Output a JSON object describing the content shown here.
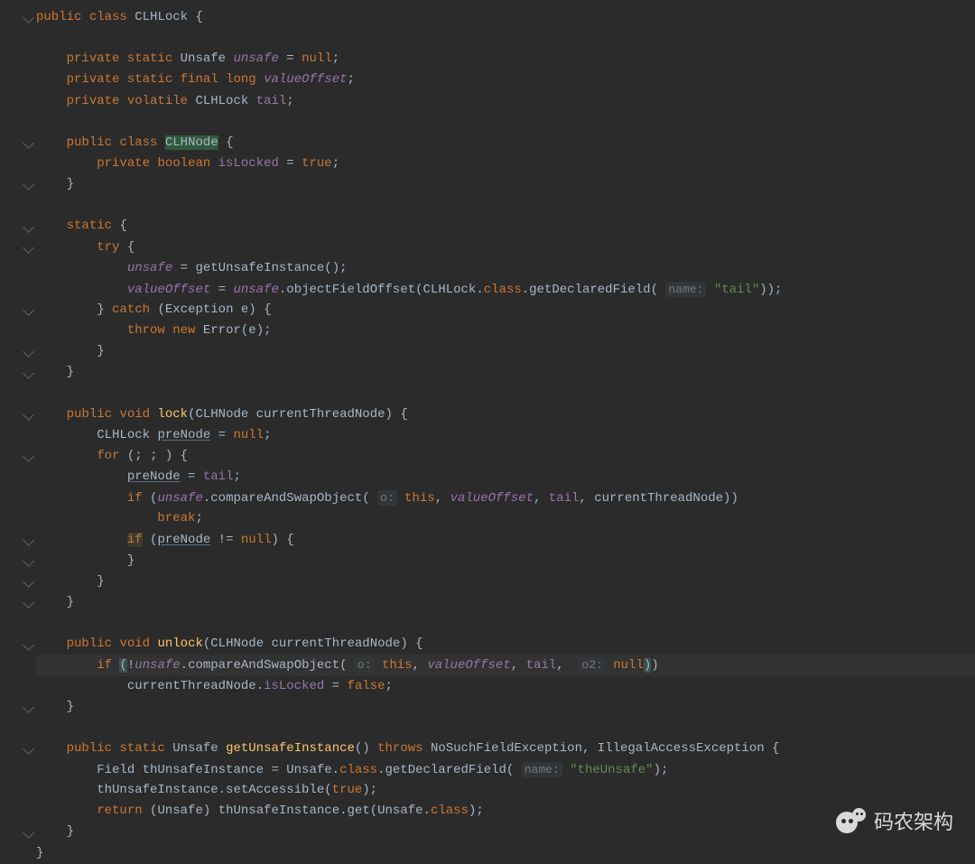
{
  "code": {
    "tokens": [
      [
        [
          "kw",
          "public"
        ],
        [
          "",
          " "
        ],
        [
          "kw",
          "class"
        ],
        [
          "",
          " "
        ],
        [
          "ident",
          "CLHLock "
        ],
        [
          "punct",
          "{"
        ]
      ],
      [],
      [
        [
          "",
          "    "
        ],
        [
          "kw",
          "private"
        ],
        [
          "",
          " "
        ],
        [
          "kw",
          "static"
        ],
        [
          "",
          " "
        ],
        [
          "ident",
          "Unsafe "
        ],
        [
          "field-it",
          "unsafe"
        ],
        [
          "",
          " = "
        ],
        [
          "kw",
          "null"
        ],
        [
          "punct",
          ";"
        ]
      ],
      [
        [
          "",
          "    "
        ],
        [
          "kw",
          "private"
        ],
        [
          "",
          " "
        ],
        [
          "kw",
          "static"
        ],
        [
          "",
          " "
        ],
        [
          "kw",
          "final"
        ],
        [
          "",
          " "
        ],
        [
          "kw",
          "long"
        ],
        [
          "",
          " "
        ],
        [
          "field-it",
          "valueOffset"
        ],
        [
          "punct",
          ";"
        ]
      ],
      [
        [
          "",
          "    "
        ],
        [
          "kw",
          "private"
        ],
        [
          "",
          " "
        ],
        [
          "kw",
          "volatile"
        ],
        [
          "",
          " "
        ],
        [
          "ident",
          "CLHLock "
        ],
        [
          "field",
          "tail"
        ],
        [
          "punct",
          ";"
        ]
      ],
      [],
      [
        [
          "",
          "    "
        ],
        [
          "kw",
          "public"
        ],
        [
          "",
          " "
        ],
        [
          "kw",
          "class"
        ],
        [
          "",
          " "
        ],
        [
          "ident highlight-ident",
          "CLHNode"
        ],
        [
          "",
          " "
        ],
        [
          "punct",
          "{"
        ]
      ],
      [
        [
          "",
          "        "
        ],
        [
          "kw",
          "private"
        ],
        [
          "",
          " "
        ],
        [
          "kw",
          "boolean"
        ],
        [
          "",
          " "
        ],
        [
          "field",
          "isLocked"
        ],
        [
          "",
          " = "
        ],
        [
          "kw",
          "true"
        ],
        [
          "punct",
          ";"
        ]
      ],
      [
        [
          "",
          "    "
        ],
        [
          "punct",
          "}"
        ]
      ],
      [],
      [
        [
          "",
          "    "
        ],
        [
          "kw",
          "static"
        ],
        [
          "",
          " "
        ],
        [
          "punct",
          "{"
        ]
      ],
      [
        [
          "",
          "        "
        ],
        [
          "kw",
          "try"
        ],
        [
          "",
          " "
        ],
        [
          "punct",
          "{"
        ]
      ],
      [
        [
          "",
          "            "
        ],
        [
          "field-it",
          "unsafe"
        ],
        [
          "",
          " = "
        ],
        [
          "ident",
          "getUnsafeInstance"
        ],
        [
          "punct",
          "();"
        ]
      ],
      [
        [
          "",
          "            "
        ],
        [
          "field-it",
          "valueOffset"
        ],
        [
          "",
          " = "
        ],
        [
          "field-it",
          "unsafe"
        ],
        [
          "punct",
          "."
        ],
        [
          "ident",
          "objectFieldOffset(CLHLock."
        ],
        [
          "kw",
          "class"
        ],
        [
          "punct",
          "."
        ],
        [
          "ident",
          "getDeclaredField("
        ],
        [
          "",
          " "
        ],
        [
          "param-hint",
          "name:"
        ],
        [
          "",
          " "
        ],
        [
          "str",
          "\"tail\""
        ],
        [
          "punct",
          "));"
        ]
      ],
      [
        [
          "",
          "        "
        ],
        [
          "punct",
          "} "
        ],
        [
          "kw",
          "catch"
        ],
        [
          "",
          " "
        ],
        [
          "punct",
          "("
        ],
        [
          "ident",
          "Exception e"
        ],
        [
          "punct",
          ") {"
        ]
      ],
      [
        [
          "",
          "            "
        ],
        [
          "kw",
          "throw"
        ],
        [
          "",
          " "
        ],
        [
          "kw",
          "new"
        ],
        [
          "",
          " "
        ],
        [
          "ident",
          "Error(e"
        ],
        [
          "punct",
          ");"
        ]
      ],
      [
        [
          "",
          "        "
        ],
        [
          "punct",
          "}"
        ]
      ],
      [
        [
          "",
          "    "
        ],
        [
          "punct",
          "}"
        ]
      ],
      [],
      [
        [
          "",
          "    "
        ],
        [
          "kw",
          "public"
        ],
        [
          "",
          " "
        ],
        [
          "kw",
          "void"
        ],
        [
          "",
          " "
        ],
        [
          "funcdef",
          "lock"
        ],
        [
          "punct",
          "("
        ],
        [
          "ident",
          "CLHNode currentThreadNode"
        ],
        [
          "punct",
          ") {"
        ]
      ],
      [
        [
          "",
          "        "
        ],
        [
          "ident",
          "CLHLock "
        ],
        [
          "ident underline",
          "preNode"
        ],
        [
          "",
          " = "
        ],
        [
          "kw",
          "null"
        ],
        [
          "punct",
          ";"
        ]
      ],
      [
        [
          "",
          "        "
        ],
        [
          "kw",
          "for"
        ],
        [
          "",
          " "
        ],
        [
          "punct",
          "("
        ],
        [
          "punct",
          ";"
        ],
        [
          "",
          " "
        ],
        [
          "punct",
          ";"
        ],
        [
          "",
          " "
        ],
        [
          "punct",
          ") {"
        ]
      ],
      [
        [
          "",
          "            "
        ],
        [
          "ident underline",
          "preNode"
        ],
        [
          "",
          " = "
        ],
        [
          "field",
          "tail"
        ],
        [
          "punct",
          ";"
        ]
      ],
      [
        [
          "",
          "            "
        ],
        [
          "kw",
          "if"
        ],
        [
          "",
          " "
        ],
        [
          "punct",
          "("
        ],
        [
          "field-it",
          "unsafe"
        ],
        [
          "punct",
          "."
        ],
        [
          "ident",
          "compareAndSwapObject("
        ],
        [
          "",
          " "
        ],
        [
          "param-hint",
          "o:"
        ],
        [
          "",
          " "
        ],
        [
          "kw",
          "this"
        ],
        [
          "punct",
          ","
        ],
        [
          "",
          " "
        ],
        [
          "field-it",
          "valueOffset"
        ],
        [
          "punct",
          ","
        ],
        [
          "",
          " "
        ],
        [
          "field",
          "tail"
        ],
        [
          "punct",
          ","
        ],
        [
          "",
          " "
        ],
        [
          "ident",
          "currentThreadNode"
        ],
        [
          "punct",
          "))"
        ]
      ],
      [
        [
          "",
          "                "
        ],
        [
          "kw",
          "break"
        ],
        [
          "punct",
          ";"
        ]
      ],
      [
        [
          "",
          "            "
        ],
        [
          "kw hlbox-y",
          "if"
        ],
        [
          "",
          " "
        ],
        [
          "punct",
          "("
        ],
        [
          "ident underline",
          "preNode"
        ],
        [
          "",
          " != "
        ],
        [
          "kw",
          "null"
        ],
        [
          "punct",
          ") {"
        ]
      ],
      [
        [
          "",
          "            "
        ],
        [
          "punct",
          "}"
        ]
      ],
      [
        [
          "",
          "        "
        ],
        [
          "punct",
          "}"
        ]
      ],
      [
        [
          "",
          "    "
        ],
        [
          "punct",
          "}"
        ]
      ],
      [],
      [
        [
          "",
          "    "
        ],
        [
          "kw",
          "public"
        ],
        [
          "",
          " "
        ],
        [
          "kw",
          "void"
        ],
        [
          "",
          " "
        ],
        [
          "funcdef",
          "unlock"
        ],
        [
          "punct",
          "("
        ],
        [
          "ident",
          "CLHNode currentThreadNode"
        ],
        [
          "punct",
          ") {"
        ]
      ],
      [
        [
          "",
          "        "
        ],
        [
          "kw",
          "if"
        ],
        [
          "",
          " "
        ],
        [
          "punct paren-match",
          "("
        ],
        [
          "punct",
          "!"
        ],
        [
          "field-it",
          "unsafe"
        ],
        [
          "punct",
          "."
        ],
        [
          "ident",
          "compareAndSwapObject("
        ],
        [
          "",
          " "
        ],
        [
          "param-hint",
          "o:"
        ],
        [
          "",
          " "
        ],
        [
          "kw",
          "this"
        ],
        [
          "punct",
          ","
        ],
        [
          "",
          " "
        ],
        [
          "field-it",
          "valueOffset"
        ],
        [
          "punct",
          ","
        ],
        [
          "",
          " "
        ],
        [
          "field",
          "tail"
        ],
        [
          "punct",
          ","
        ],
        [
          "",
          "  "
        ],
        [
          "param-hint",
          "o2:"
        ],
        [
          "",
          " "
        ],
        [
          "kw",
          "null"
        ],
        [
          "punct paren-match",
          ")"
        ],
        [
          "punct",
          ")"
        ]
      ],
      [
        [
          "",
          "            "
        ],
        [
          "ident",
          "currentThreadNode."
        ],
        [
          "field",
          "isLocked"
        ],
        [
          "",
          " = "
        ],
        [
          "kw",
          "false"
        ],
        [
          "punct",
          ";"
        ]
      ],
      [
        [
          "",
          "    "
        ],
        [
          "punct",
          "}"
        ]
      ],
      [],
      [
        [
          "",
          "    "
        ],
        [
          "kw",
          "public"
        ],
        [
          "",
          " "
        ],
        [
          "kw",
          "static"
        ],
        [
          "",
          " "
        ],
        [
          "ident",
          "Unsafe "
        ],
        [
          "funcdef",
          "getUnsafeInstance"
        ],
        [
          "punct",
          "()"
        ],
        [
          "",
          " "
        ],
        [
          "kw",
          "throws"
        ],
        [
          "",
          " "
        ],
        [
          "ident",
          "NoSuchFieldException"
        ],
        [
          "punct",
          ","
        ],
        [
          "",
          " "
        ],
        [
          "ident",
          "IllegalAccessException"
        ],
        [
          "",
          " "
        ],
        [
          "punct",
          "{"
        ]
      ],
      [
        [
          "",
          "        "
        ],
        [
          "ident",
          "Field thUnsafeInstance = Unsafe."
        ],
        [
          "kw",
          "class"
        ],
        [
          "punct",
          "."
        ],
        [
          "ident",
          "getDeclaredField("
        ],
        [
          "",
          " "
        ],
        [
          "param-hint",
          "name:"
        ],
        [
          "",
          " "
        ],
        [
          "str",
          "\"theUnsafe\""
        ],
        [
          "punct",
          ");"
        ]
      ],
      [
        [
          "",
          "        "
        ],
        [
          "ident",
          "thUnsafeInstance.setAccessible("
        ],
        [
          "kw",
          "true"
        ],
        [
          "punct",
          ");"
        ]
      ],
      [
        [
          "",
          "        "
        ],
        [
          "kw",
          "return"
        ],
        [
          "",
          " "
        ],
        [
          "punct",
          "("
        ],
        [
          "ident",
          "Unsafe"
        ],
        [
          "punct",
          ") "
        ],
        [
          "ident",
          "thUnsafeInstance.get(Unsafe."
        ],
        [
          "kw",
          "class"
        ],
        [
          "punct",
          ");"
        ]
      ],
      [
        [
          "",
          "    "
        ],
        [
          "punct",
          "}"
        ]
      ],
      [
        [
          "punct",
          "}"
        ]
      ]
    ],
    "highlightedLineIndex": 31
  },
  "foldMarkerLines": [
    0,
    6,
    8,
    10,
    11,
    14,
    16,
    17,
    19,
    21,
    25,
    26,
    27,
    28,
    30,
    33,
    35,
    39
  ],
  "watermark": {
    "text": "码农架构"
  }
}
